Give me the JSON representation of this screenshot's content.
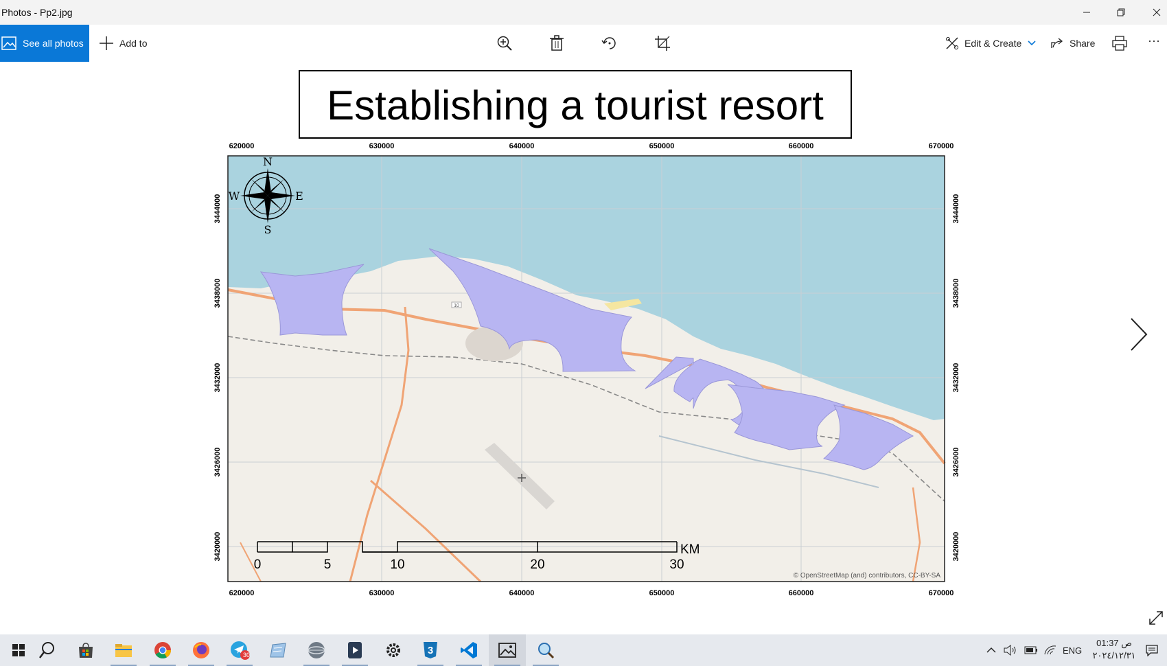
{
  "window": {
    "title": "Photos - Pp2.jpg",
    "buttons": [
      "minimize-button",
      "maximize-button",
      "close-button"
    ]
  },
  "toolbar": {
    "see_all_label": "See all photos",
    "add_to_label": "Add to",
    "edit_create_label": "Edit & Create",
    "share_label": "Share",
    "more_label": "···",
    "accent": "#0a78d7",
    "icons": [
      "zoom-icon",
      "delete-icon",
      "rotate-icon",
      "crop-icon",
      "print-icon"
    ]
  },
  "map": {
    "title": "Establishing a tourist resort",
    "x_ticks": [
      "620000",
      "630000",
      "640000",
      "650000",
      "660000",
      "670000"
    ],
    "y_ticks": [
      "3444000",
      "3438000",
      "3432000",
      "3426000",
      "3420000"
    ],
    "compass": {
      "n": "N",
      "s": "S",
      "e": "E",
      "w": "W"
    },
    "scale_labels": [
      "0",
      "5",
      "10",
      "20",
      "30"
    ],
    "scale_unit": "KM",
    "attribution": "© OpenStreetMap (and) contributors, CC-BY-SA",
    "road_label": "10",
    "colors": {
      "sea": "#aad3df",
      "land": "#f2efe9",
      "resort_zone": "#b8b5f2",
      "road": "#f0a475"
    }
  },
  "taskbar": {
    "apps": [
      "windows-start-icon",
      "search-icon",
      "store-icon",
      "file-explorer-icon",
      "chrome-icon",
      "firefox-icon",
      "telegram-icon",
      "notes-app-icon",
      "globe-app-icon",
      "media-app-icon",
      "settings-icon",
      "css-app-icon",
      "vscode-icon",
      "photos-icon",
      "magnifier-icon"
    ],
    "telegram_badge": "30",
    "language": "ENG",
    "time": "01:37 ص",
    "date": "٢٠٢٤/١٢/٣١"
  }
}
